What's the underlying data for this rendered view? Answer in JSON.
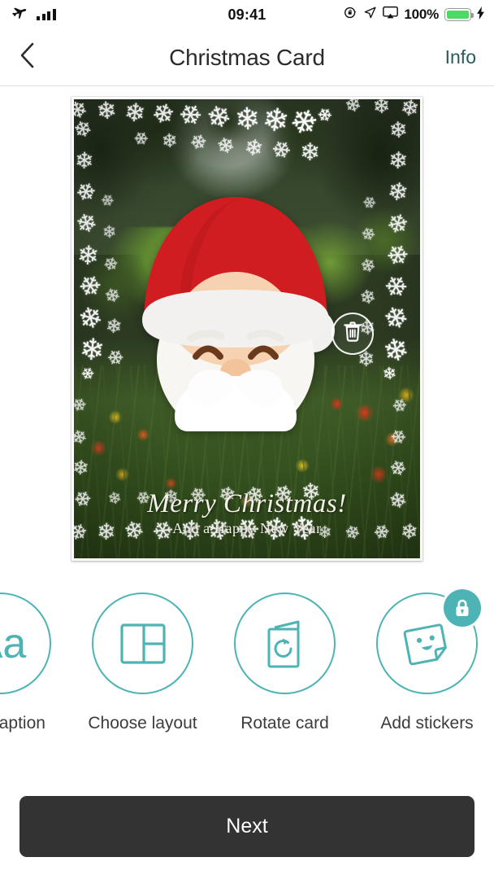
{
  "status_bar": {
    "airplane_icon": "airplane-icon",
    "signal_icon": "signal-bars-icon",
    "time": "09:41",
    "rotation_lock_icon": "rotation-lock-icon",
    "location_icon": "location-arrow-icon",
    "airplay_icon": "airplay-icon",
    "battery_percent": "100%",
    "battery_icon": "battery-icon",
    "charging_icon": "lightning-bolt-icon",
    "battery_fill_color": "#4cd964"
  },
  "nav_bar": {
    "back_icon": "chevron-left-icon",
    "title": "Christmas Card",
    "info_label": "Info",
    "info_color": "#2a5a5c"
  },
  "card": {
    "greeting_line1": "Merry Christmas!",
    "greeting_line2": "And a Happy New Year",
    "sticker_name": "santa-face-sticker",
    "delete_icon": "trash-icon",
    "frame_style": "snowflake-border",
    "photo_description": "garden-photo"
  },
  "toolbar": {
    "accent_color": "#4eb3b5",
    "items": [
      {
        "label": "Add caption",
        "icon": "text-aa-icon",
        "icon_text": "Aa",
        "locked": false
      },
      {
        "label": "Choose layout",
        "icon": "grid-layout-icon",
        "icon_text": "",
        "locked": false
      },
      {
        "label": "Rotate card",
        "icon": "rotate-card-icon",
        "icon_text": "",
        "locked": false
      },
      {
        "label": "Add stickers",
        "icon": "sticker-smiley-icon",
        "icon_text": "",
        "locked": true,
        "lock_icon": "padlock-icon"
      }
    ]
  },
  "footer": {
    "next_label": "Next",
    "next_bg": "#333333"
  }
}
